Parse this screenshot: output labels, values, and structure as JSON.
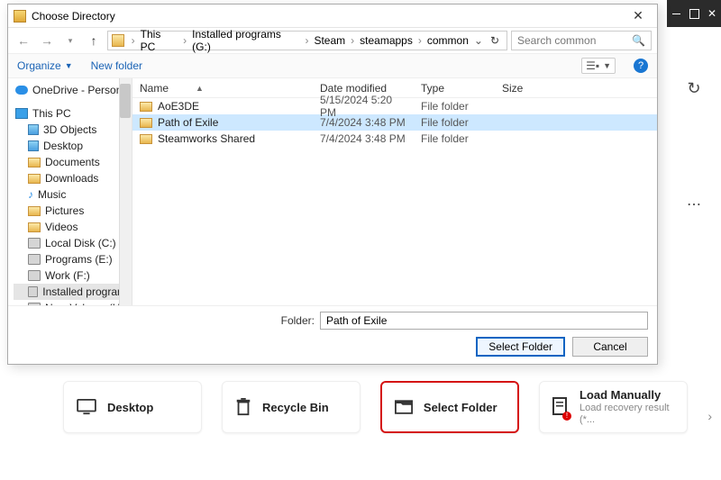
{
  "dialog": {
    "title": "Choose Directory",
    "breadcrumbs": [
      "This PC",
      "Installed programs (G:)",
      "Steam",
      "steamapps",
      "common"
    ],
    "search_placeholder": "Search common",
    "toolbar": {
      "organize": "Organize",
      "new_folder": "New folder"
    },
    "columns": {
      "name": "Name",
      "date": "Date modified",
      "type": "Type",
      "size": "Size"
    },
    "rows": [
      {
        "name": "AoE3DE",
        "date": "5/15/2024 5:20 PM",
        "type": "File folder",
        "selected": false
      },
      {
        "name": "Path of Exile",
        "date": "7/4/2024 3:48 PM",
        "type": "File folder",
        "selected": true
      },
      {
        "name": "Steamworks Shared",
        "date": "7/4/2024 3:48 PM",
        "type": "File folder",
        "selected": false
      }
    ],
    "tree": {
      "onedrive": "OneDrive - Person",
      "thispc": "This PC",
      "items": [
        "3D Objects",
        "Desktop",
        "Documents",
        "Downloads",
        "Music",
        "Pictures",
        "Videos",
        "Local Disk (C:)",
        "Programs (E:)",
        "Work (F:)",
        "Installed programs",
        "New Volume (H:)"
      ]
    },
    "folder_label": "Folder:",
    "folder_value": "Path of Exile",
    "select_btn": "Select Folder",
    "cancel_btn": "Cancel"
  },
  "cards": {
    "desktop": "Desktop",
    "recycle": "Recycle Bin",
    "select": "Select Folder",
    "load_title": "Load Manually",
    "load_sub": "Load recovery result (*..."
  }
}
